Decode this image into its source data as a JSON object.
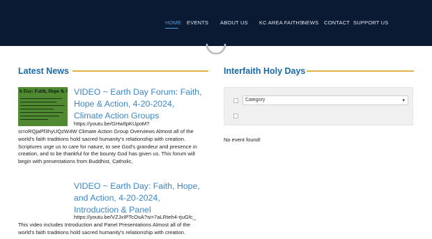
{
  "nav": {
    "items": [
      {
        "label": "HOME",
        "active": true
      },
      {
        "label": "EVENTS",
        "active": false
      },
      {
        "label": "ABOUT US",
        "active": false
      },
      {
        "label": "KC AREA FAITHS",
        "active": false
      },
      {
        "label": "NEWS",
        "active": false
      },
      {
        "label": "CONTACT",
        "active": false
      },
      {
        "label": "SUPPORT US",
        "active": false
      }
    ]
  },
  "latest_news": {
    "heading": "Latest News",
    "posts": [
      {
        "title_lines": [
          "VIDEO ~ Earth Day Forum: Faith,",
          "Hope & Action, 4-20-2024,",
          "Climate Action Groups"
        ],
        "thumbnail_title": "h Day: Faith, Hope & Actio",
        "body_lines": [
          "https://youtu.be/GHwIlpKUpoM?",
          "si=oRQjaPf3hyUQzW4W   Climate Action Group Overviews Almost all of the",
          "world's faith traditions hold sacred humanity's relationship with creation.",
          "Scriptures urge us to care for nature, to see God's grandeur and presence in",
          "creation, and to be thankful for the bounty God has given us. This forum will",
          "begin with presentations from Buddhist, Catholic,"
        ]
      },
      {
        "title_lines": [
          "VIDEO ~ Earth Day: Faith, Hope,",
          "and Action, 4-20-2024,",
          "Introduction & Panel"
        ],
        "body_lines": [
          "https://youtu.be/VZJxIPTcOsA?si=7aLRteh4-rjuGfc_",
          "This video includes Introduction and Panel Presentations Almost all of the",
          "world's faith traditions hold sacred humanity's relationship with creation."
        ]
      }
    ]
  },
  "holy_days": {
    "heading": "Interfaith Holy Days",
    "category_select": "Category",
    "empty_message": "No event found!"
  },
  "colors": {
    "topbar": "#0b1a33",
    "nav_active": "#4a9fe0",
    "heading": "#1b6aa8",
    "heading_rule": "#e2b246",
    "post_title": "#3a86c6"
  }
}
